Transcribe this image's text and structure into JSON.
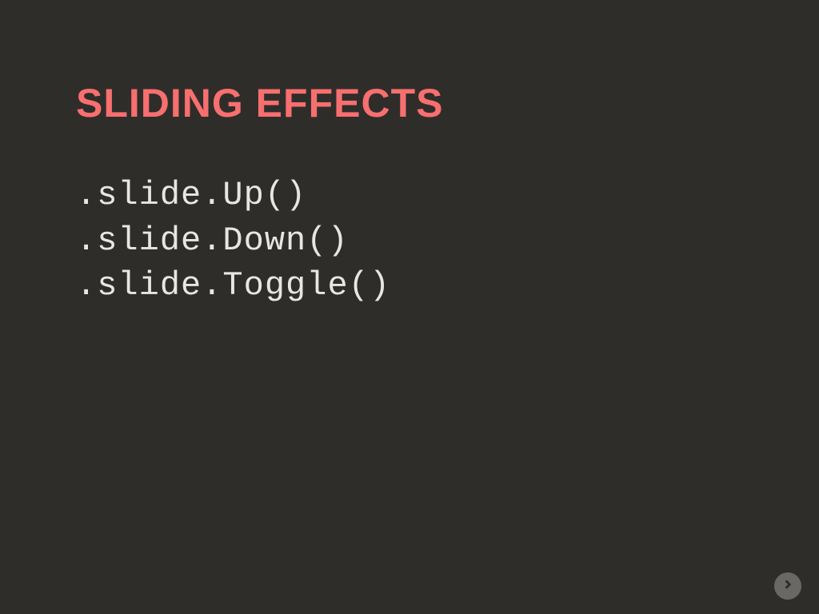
{
  "slide": {
    "title": "SLIDING EFFECTS",
    "lines": [
      ".slide.Up()",
      ".slide.Down()",
      ".slide.Toggle()"
    ]
  },
  "nav": {
    "next_icon": "arrow-right-icon"
  }
}
